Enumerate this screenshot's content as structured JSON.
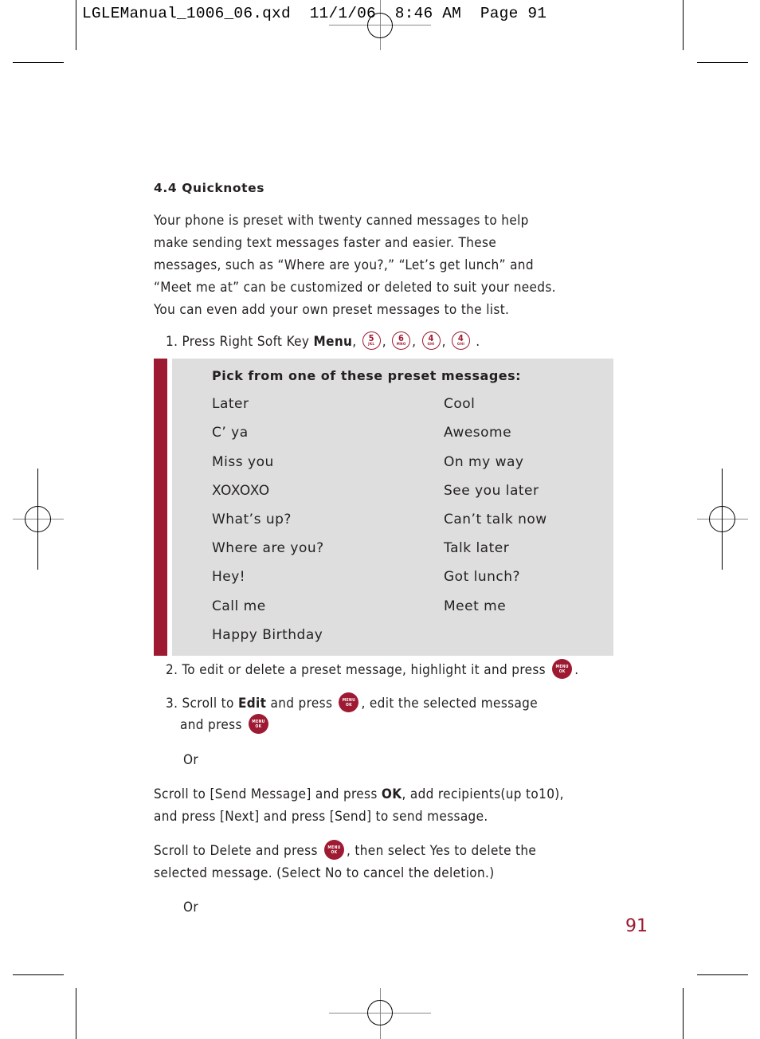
{
  "slug": "LGLEManual_1006_06.qxd  11/1/06  8:46 AM  Page 91",
  "section": {
    "heading": "4.4 Quicknotes",
    "intro_lines": [
      "Your phone is preset with twenty canned messages to help",
      "make sending text messages faster and easier. These",
      "messages, such as “Where are you?,” “Let’s get lunch” and",
      "“Meet me at” can be customized or deleted to suit your needs.",
      "You can even add your own preset messages to the list."
    ]
  },
  "step1": {
    "prefix": "1. Press Right Soft Key ",
    "bold": "Menu",
    "keys": [
      {
        "num": "5",
        "letters": "JKL"
      },
      {
        "num": "6",
        "letters": "MNO"
      },
      {
        "num": "4",
        "letters": "GHI"
      },
      {
        "num": "4",
        "letters": "GHI"
      }
    ],
    "sep": ",",
    "end": "."
  },
  "preset_box": {
    "title": "Pick from  one of these preset messages:",
    "left_column": [
      "Later",
      "C’ ya",
      "Miss you",
      "XOXOXO",
      "What’s up?",
      "Where are you?",
      "Hey!",
      "Call me",
      "Happy Birthday"
    ],
    "right_column": [
      "Cool",
      "Awesome",
      "On my way",
      "See you later",
      "Can’t talk now",
      "Talk later",
      "Got lunch?",
      "Meet me"
    ]
  },
  "menu_ok_key": {
    "top": "MENU",
    "bottom": "OK"
  },
  "step2": {
    "text": "2. To edit or delete a preset message, highlight it and press",
    "end": "."
  },
  "step3": {
    "prefix": "3. Scroll to ",
    "bold": "Edit",
    "mid": " and press",
    "after": ", edit the selected message",
    "line2": "and press"
  },
  "or_1": "Or",
  "send_para": {
    "pre": "Scroll to [Send Message] and press ",
    "bold": "OK",
    "post": ", add recipients(up to10),",
    "line2": "and press [Next] and press [Send] to send message."
  },
  "delete_para": {
    "pre": "Scroll to Delete and press",
    "post": ", then select Yes to delete the",
    "line2": "selected message. (Select No to cancel the deletion.)"
  },
  "or_2": "Or",
  "page_number": "91",
  "colors": {
    "accent": "#9d1a32",
    "box_bg": "#dedede",
    "text": "#231f20"
  }
}
